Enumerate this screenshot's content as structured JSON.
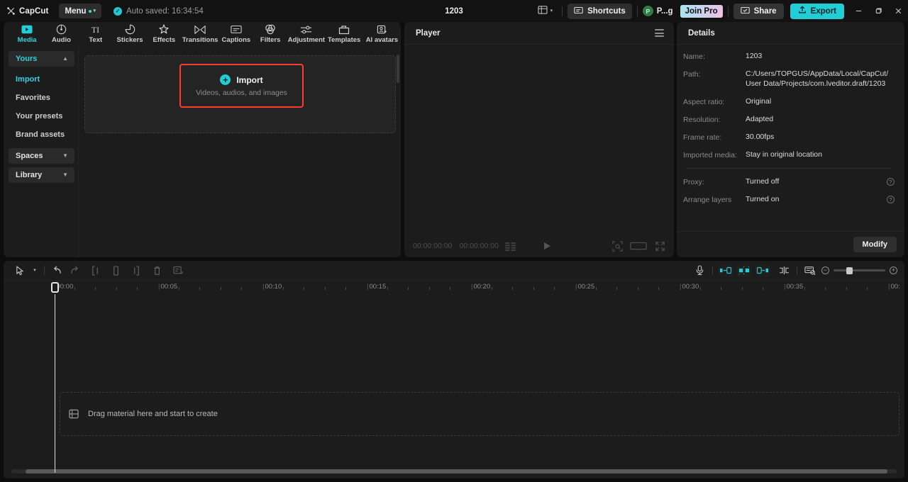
{
  "titlebar": {
    "brand": "CapCut",
    "menu_label": "Menu",
    "autosave": "Auto saved: 16:34:54",
    "project_title": "1203",
    "shortcuts_label": "Shortcuts",
    "account_initial": "P",
    "account_name": "P...g",
    "join_pro_label": "Join Pro",
    "share_label": "Share",
    "export_label": "Export",
    "minimize": "—",
    "maximize": "❐",
    "close": "✕"
  },
  "tabs": [
    {
      "label": "Media",
      "icon": "media-icon",
      "active": true
    },
    {
      "label": "Audio",
      "icon": "audio-icon",
      "active": false
    },
    {
      "label": "Text",
      "icon": "text-icon",
      "active": false
    },
    {
      "label": "Stickers",
      "icon": "stickers-icon",
      "active": false
    },
    {
      "label": "Effects",
      "icon": "effects-icon",
      "active": false
    },
    {
      "label": "Transitions",
      "icon": "transitions-icon",
      "active": false
    },
    {
      "label": "Captions",
      "icon": "captions-icon",
      "active": false
    },
    {
      "label": "Filters",
      "icon": "filters-icon",
      "active": false
    },
    {
      "label": "Adjustment",
      "icon": "adjustment-icon",
      "active": false
    },
    {
      "label": "Templates",
      "icon": "templates-icon",
      "active": false
    },
    {
      "label": "AI avatars",
      "icon": "ai-avatars-icon",
      "active": false
    }
  ],
  "sidebar": {
    "group_yours": "Yours",
    "items": [
      {
        "label": "Import",
        "selected": true
      },
      {
        "label": "Favorites",
        "selected": false
      },
      {
        "label": "Your presets",
        "selected": false
      },
      {
        "label": "Brand assets",
        "selected": false
      }
    ],
    "group_spaces": "Spaces",
    "group_library": "Library"
  },
  "media": {
    "import_title": "Import",
    "import_subtitle": "Videos, audios, and images"
  },
  "player": {
    "title": "Player",
    "current_time": "00:00:00:00",
    "total_time": "00:00:00:00"
  },
  "details": {
    "title": "Details",
    "rows": [
      {
        "label": "Name:",
        "value": "1203"
      },
      {
        "label": "Path:",
        "value": "C:/Users/TOPGUS/AppData/Local/CapCut/User Data/Projects/com.lveditor.draft/1203"
      },
      {
        "label": "Aspect ratio:",
        "value": "Original"
      },
      {
        "label": "Resolution:",
        "value": "Adapted"
      },
      {
        "label": "Frame rate:",
        "value": "30.00fps"
      },
      {
        "label": "Imported media:",
        "value": "Stay in original location"
      }
    ],
    "rows2": [
      {
        "label": "Proxy:",
        "value": "Turned off",
        "help": "?"
      },
      {
        "label": "Arrange layers",
        "value": "Turned on",
        "help": "?"
      }
    ],
    "modify_label": "Modify"
  },
  "timeline": {
    "ruler_labels": [
      "00:00",
      "00:05",
      "00:10",
      "00:15",
      "00:20",
      "00:25",
      "00:30",
      "00:35",
      "00:"
    ],
    "drop_hint": "Drag material here and start to create",
    "zoom_out": "−",
    "zoom_in": "+"
  },
  "colors": {
    "accent": "#22cdd6",
    "highlight_box": "#ff3b30",
    "panel_bg": "#1c1c1c",
    "app_bg": "#0d0d0d"
  }
}
